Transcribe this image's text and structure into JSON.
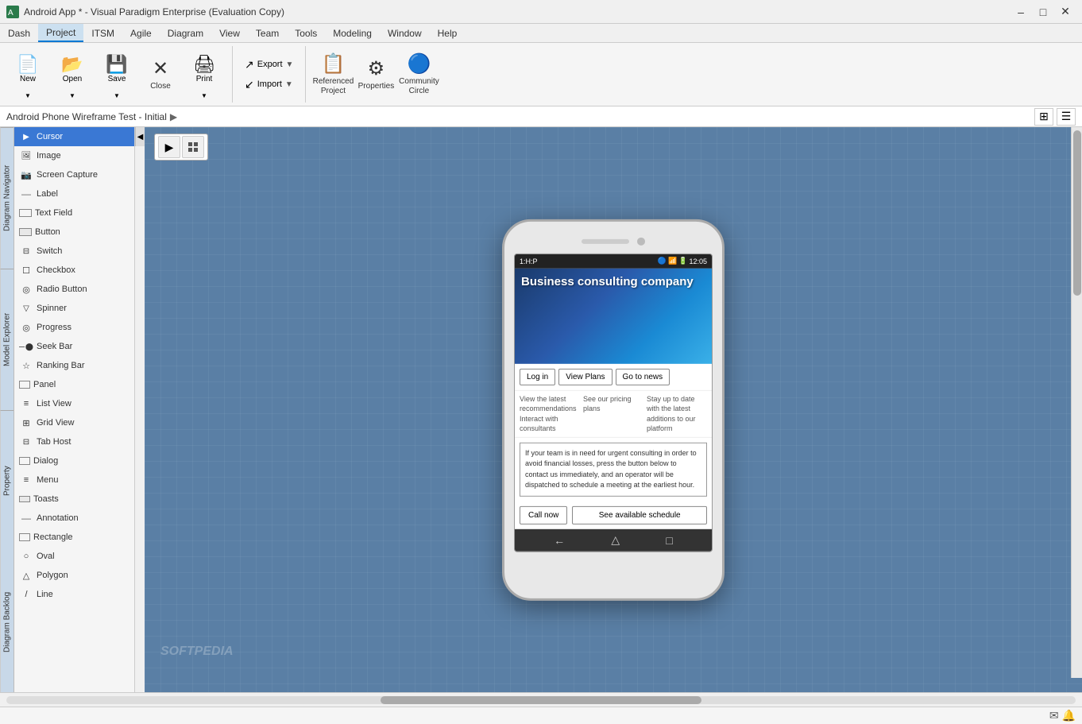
{
  "titleBar": {
    "title": "Android App * - Visual Paradigm Enterprise (Evaluation Copy)",
    "minimize": "–",
    "maximize": "□",
    "close": "✕"
  },
  "menuBar": {
    "items": [
      {
        "label": "Dash",
        "active": false
      },
      {
        "label": "Project",
        "active": true
      },
      {
        "label": "ITSM",
        "active": false
      },
      {
        "label": "Agile",
        "active": false
      },
      {
        "label": "Diagram",
        "active": false
      },
      {
        "label": "View",
        "active": false
      },
      {
        "label": "Team",
        "active": false
      },
      {
        "label": "Tools",
        "active": false
      },
      {
        "label": "Modeling",
        "active": false
      },
      {
        "label": "Window",
        "active": false
      },
      {
        "label": "Help",
        "active": false
      }
    ]
  },
  "toolbar": {
    "groups": [
      {
        "buttons": [
          {
            "label": "New",
            "icon": "📄",
            "split": true
          },
          {
            "label": "Open",
            "icon": "📂",
            "split": true
          },
          {
            "label": "Save",
            "icon": "💾",
            "split": true
          },
          {
            "label": "Close",
            "icon": "✕",
            "split": false
          },
          {
            "label": "Print",
            "icon": "🖨",
            "split": true
          }
        ]
      },
      {
        "exportLabel": "Export",
        "importLabel": "Import"
      },
      {
        "buttons": [
          {
            "label": "Referenced\nProject",
            "icon": "📋"
          },
          {
            "label": "Properties",
            "icon": "⚙"
          },
          {
            "label": "Community\nCircle",
            "icon": "🔵"
          }
        ]
      }
    ]
  },
  "breadcrumb": {
    "text": "Android Phone Wireframe Test - Initial",
    "arrow": "▶"
  },
  "sidebar": {
    "items": [
      {
        "label": "Cursor",
        "iconClass": "icon-cursor",
        "active": true
      },
      {
        "label": "Image",
        "iconClass": "icon-image"
      },
      {
        "label": "Screen Capture",
        "iconClass": "icon-screen"
      },
      {
        "label": "Label",
        "iconClass": "icon-label"
      },
      {
        "label": "Text Field",
        "iconClass": "icon-textfield"
      },
      {
        "label": "Button",
        "iconClass": "icon-button"
      },
      {
        "label": "Switch",
        "iconClass": "icon-switch"
      },
      {
        "label": "Checkbox",
        "iconClass": "icon-checkbox"
      },
      {
        "label": "Radio Button",
        "iconClass": "icon-radio"
      },
      {
        "label": "Spinner",
        "iconClass": "icon-spinner"
      },
      {
        "label": "Progress",
        "iconClass": "icon-progress"
      },
      {
        "label": "Seek Bar",
        "iconClass": "icon-seekbar"
      },
      {
        "label": "Ranking Bar",
        "iconClass": "icon-ranking"
      },
      {
        "label": "Panel",
        "iconClass": "icon-panel"
      },
      {
        "label": "List View",
        "iconClass": "icon-list"
      },
      {
        "label": "Grid View",
        "iconClass": "icon-grid"
      },
      {
        "label": "Tab Host",
        "iconClass": "icon-tabhost"
      },
      {
        "label": "Dialog",
        "iconClass": "icon-dialog"
      },
      {
        "label": "Menu",
        "iconClass": "icon-menu"
      },
      {
        "label": "Toasts",
        "iconClass": "icon-toasts"
      },
      {
        "label": "Annotation",
        "iconClass": "icon-annotation"
      },
      {
        "label": "Rectangle",
        "iconClass": "icon-rectangle"
      },
      {
        "label": "Oval",
        "iconClass": "icon-oval"
      },
      {
        "label": "Polygon",
        "iconClass": "icon-polygon"
      },
      {
        "label": "Line",
        "iconClass": "icon-line"
      }
    ]
  },
  "phone": {
    "statusBar": {
      "left": "1:H:P",
      "icons": "🔵 📶 🔋",
      "time": "12:05"
    },
    "heroTitle": "Business consulting company",
    "actions": [
      {
        "label": "Log in"
      },
      {
        "label": "View Plans"
      },
      {
        "label": "Go to news"
      }
    ],
    "infoColumns": [
      {
        "text": "View the latest recommendations Interact with consultants"
      },
      {
        "text": "See our pricing plans"
      },
      {
        "text": "Stay up to date with the latest additions to our platform"
      }
    ],
    "urgentText": "If your team is in need for urgent consulting in order to avoid financial losses, press the button below to contact us immediately, and an operator will be dispatched to schedule a meeting at the earliest hour.",
    "ctaButtons": [
      {
        "label": "Call now"
      },
      {
        "label": "See available schedule"
      }
    ]
  },
  "sideLabels": {
    "diagramNavigator": "Diagram Navigator",
    "modelExplorer": "Model Explorer",
    "property": "Property",
    "diagramBacklog": "Diagram Backlog"
  },
  "watermark": "SOFTPEDIA"
}
